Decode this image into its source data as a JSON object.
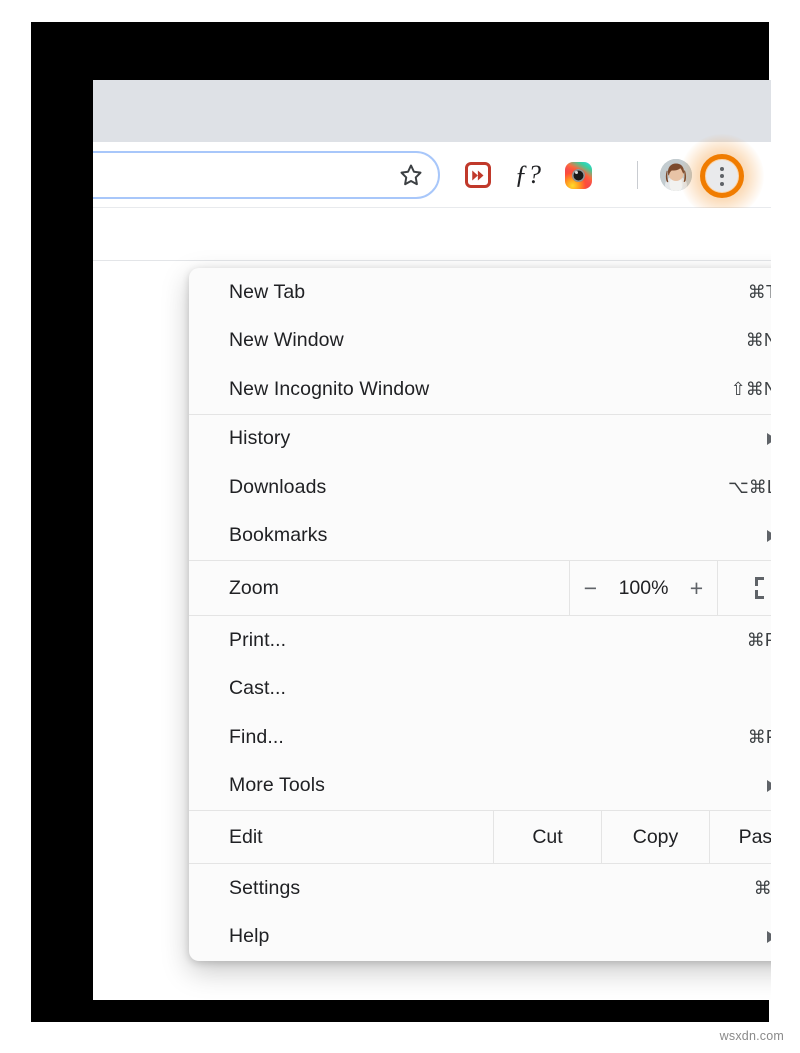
{
  "browser": {
    "toolbar": {
      "omnibox": {
        "value": "",
        "placeholder": "",
        "bookmark_icon": "star-icon"
      },
      "extensions": [
        {
          "name": "fast-forward-extension-icon",
          "label": ""
        },
        {
          "name": "f-question-extension-icon",
          "label": "ƒ?"
        },
        {
          "name": "camera-extension-icon",
          "label": ""
        }
      ],
      "profile": {
        "name": "avatar",
        "label": ""
      },
      "menu_button": {
        "name": "three-dot-menu-button",
        "label": "",
        "highlight_color": "#f07c00"
      }
    }
  },
  "menu": {
    "groups": [
      {
        "type": "items",
        "items": [
          {
            "label": "New Tab",
            "accel": "⌘T",
            "arrow": false
          },
          {
            "label": "New Window",
            "accel": "⌘N",
            "arrow": false
          },
          {
            "label": "New Incognito Window",
            "accel": "⇧⌘N",
            "arrow": false
          }
        ]
      },
      {
        "type": "items",
        "items": [
          {
            "label": "History",
            "accel": "",
            "arrow": true
          },
          {
            "label": "Downloads",
            "accel": "⌥⌘L",
            "arrow": false
          },
          {
            "label": "Bookmarks",
            "accel": "",
            "arrow": true
          }
        ]
      },
      {
        "type": "zoom",
        "zoom": {
          "label": "Zoom",
          "decrease": "−",
          "value": "100%",
          "increase": "+",
          "fullscreen_icon": "fullscreen-icon"
        }
      },
      {
        "type": "items",
        "items": [
          {
            "label": "Print...",
            "accel": "⌘P",
            "arrow": false
          },
          {
            "label": "Cast...",
            "accel": "",
            "arrow": false
          },
          {
            "label": "Find...",
            "accel": "⌘F",
            "arrow": false
          },
          {
            "label": "More Tools",
            "accel": "",
            "arrow": true
          }
        ]
      },
      {
        "type": "edit",
        "edit": {
          "label": "Edit",
          "cut": "Cut",
          "copy": "Copy",
          "paste": "Paste"
        }
      },
      {
        "type": "items",
        "items": [
          {
            "label": "Settings",
            "accel": "⌘,",
            "arrow": false
          },
          {
            "label": "Help",
            "accel": "",
            "arrow": true
          }
        ]
      }
    ]
  },
  "watermark": {
    "text": "wsxdn.com"
  }
}
